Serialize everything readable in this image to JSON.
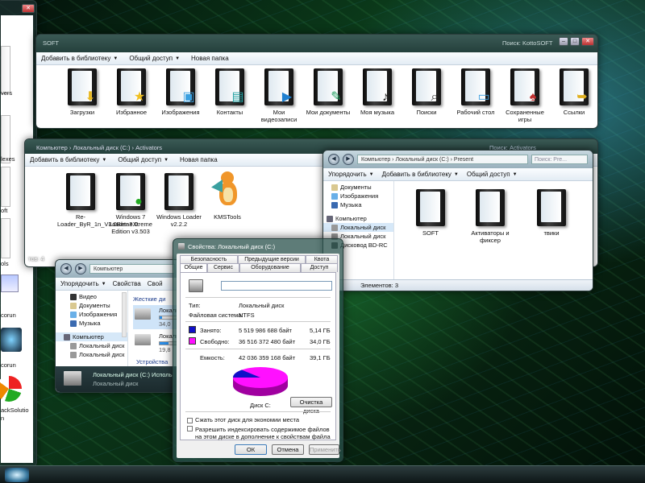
{
  "top_window": {
    "search": "Поиск: KottoSOFT",
    "address_hint": "SOFT",
    "toolbar": [
      "Добавить в библиотеку",
      "Общий доступ",
      "Новая папка"
    ],
    "folders": [
      {
        "label": "Загрузки",
        "badge": "download-arrow"
      },
      {
        "label": "Избранное",
        "badge": "star"
      },
      {
        "label": "Изображения",
        "badge": "photo"
      },
      {
        "label": "Контакты",
        "badge": "contact-card"
      },
      {
        "label": "Мои видеозаписи",
        "badge": "film"
      },
      {
        "label": "Мои документы",
        "badge": "document"
      },
      {
        "label": "Моя музыка",
        "badge": "music-note"
      },
      {
        "label": "Поиски",
        "badge": "magnifier"
      },
      {
        "label": "Рабочий стол",
        "badge": "desktop"
      },
      {
        "label": "Сохраненные игры",
        "badge": "games"
      },
      {
        "label": "Ссылки",
        "badge": "link-arrow"
      }
    ]
  },
  "activators_window": {
    "address": "Компьютер  ›  Локальный диск (C:)  ›  Activators",
    "search": "Поиск: Activators",
    "toolbar": [
      "Добавить в библиотеку",
      "Общий доступ",
      "Новая папка"
    ],
    "items": [
      {
        "label": "Re-Loader_ByR_1n_V3.0Beta3.0",
        "kind": "folder"
      },
      {
        "label": "Windows 7 Loader eXtreme Edition v3.503",
        "kind": "folder"
      },
      {
        "label": "Windows Loader v2.2.2",
        "kind": "folder"
      },
      {
        "label": "KMSTools",
        "kind": "dragon"
      }
    ],
    "count_hint": "тов: 4"
  },
  "present_window": {
    "address": "Компьютер  ›  Локальный диск (C:)  ›  Present",
    "search": "Поиск: Pre...",
    "toolbar": [
      "Упорядочить",
      "Добавить в библиотеку",
      "Общий доступ"
    ],
    "tree": [
      "Документы",
      "Изображения",
      "Музыка",
      "Компьютер",
      "Локальный диск",
      "Локальный диск",
      "Дисковод BD-RC"
    ],
    "folders": [
      "SOFT",
      "Активаторы и фиксер",
      "твики"
    ],
    "status": "Элементов: 3"
  },
  "computer_window": {
    "address": "Компьютер",
    "toolbar": [
      "Упорядочить",
      "Свойства",
      "Свой"
    ],
    "tree": [
      "Видео",
      "Документы",
      "Изображения",
      "Музыка",
      "Компьютер",
      "Локальный диск",
      "Локальный диск"
    ],
    "section_hdd": "Жесткие ди",
    "disk1_name": "Локальный",
    "disk1_free": "34,0",
    "disk2_name": "Локальный",
    "disk2_free": "19,8",
    "section_devices": "Устройства",
    "status_name": "Локальный диск (C:) Исполь",
    "status_sub": "Локальный диск"
  },
  "properties_dialog": {
    "title": "Свойства: Локальный диск (C:)",
    "tabs_row1": [
      "Безопасность",
      "Предыдущие версии",
      "Квота"
    ],
    "tabs_row2": [
      "Общие",
      "Сервис",
      "Оборудование",
      "Доступ"
    ],
    "type_label": "Тип:",
    "type_value": "Локальный диск",
    "fs_label": "Файловая система:",
    "fs_value": "NTFS",
    "used_label": "Занято:",
    "used_bytes": "5 519 986 688 байт",
    "used_gb": "5,14 ГБ",
    "free_label": "Свободно:",
    "free_bytes": "36 516 372 480 байт",
    "free_gb": "34,0 ГБ",
    "cap_label": "Емкость:",
    "cap_bytes": "42 036 359 168 байт",
    "cap_gb": "39,1 ГБ",
    "disk_label": "Диск C:",
    "cleanup": "Очистка диска",
    "compress": "Сжать этот диск для экономии места",
    "index": "Разрешить индексировать содержимое файлов на этом диске в дополнение к свойствам файла",
    "ok": "ОК",
    "cancel": "Отмена",
    "apply": "Применить",
    "used_fraction": 0.131,
    "used_color": "#1010c8",
    "free_color": "#ff10ff"
  },
  "left_window": {
    "labels": [
      "vers",
      "lexes",
      "oft",
      "ols",
      "corun",
      "corun",
      "ackSolutio",
      "n"
    ]
  }
}
